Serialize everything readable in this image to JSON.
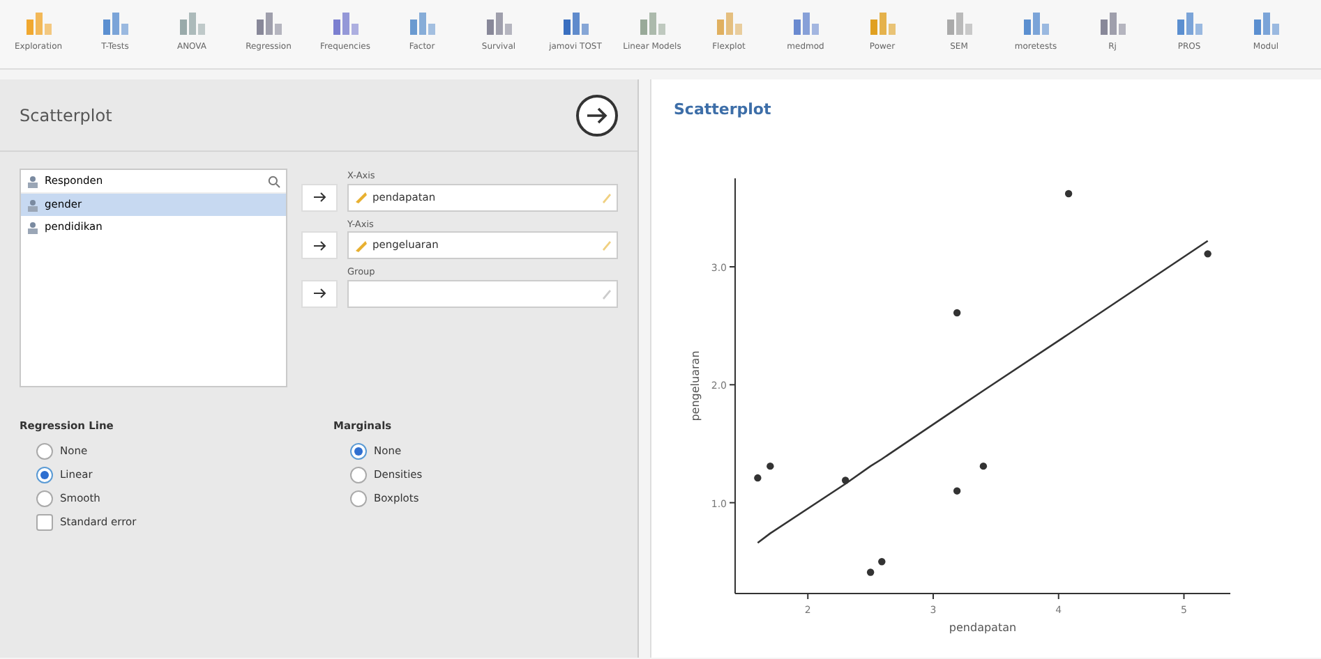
{
  "toolbar": [
    {
      "label": "Exploration"
    },
    {
      "label": "T-Tests"
    },
    {
      "label": "ANOVA"
    },
    {
      "label": "Regression"
    },
    {
      "label": "Frequencies"
    },
    {
      "label": "Factor"
    },
    {
      "label": "Survival"
    },
    {
      "label": "jamovi TOST"
    },
    {
      "label": "Linear Models"
    },
    {
      "label": "Flexplot"
    },
    {
      "label": "medmod"
    },
    {
      "label": "Power"
    },
    {
      "label": "SEM"
    },
    {
      "label": "moretests"
    },
    {
      "label": "Rj"
    },
    {
      "label": "PROS"
    },
    {
      "label": "Modul"
    }
  ],
  "options_panel": {
    "title": "Scatterplot",
    "variables": [
      {
        "name": "Responden",
        "kind": "nominal",
        "selected": false
      },
      {
        "name": "gender",
        "kind": "nominal",
        "selected": true
      },
      {
        "name": "pendidikan",
        "kind": "nominal",
        "selected": false
      }
    ],
    "targets": [
      {
        "label": "X-Axis",
        "value": "pendapatan"
      },
      {
        "label": "Y-Axis",
        "value": "pengeluaran"
      },
      {
        "label": "Group"
      }
    ],
    "regression_line": {
      "title": "Regression Line",
      "options": [
        {
          "label": "None",
          "kind": "radio",
          "selected": false
        },
        {
          "label": "Linear",
          "kind": "radio",
          "selected": true
        },
        {
          "label": "Smooth",
          "kind": "radio",
          "selected": false
        },
        {
          "label": "Standard error",
          "kind": "checkbox",
          "checked": false
        }
      ]
    },
    "marginals": {
      "title": "Marginals",
      "options": [
        {
          "label": "None",
          "selected": true
        },
        {
          "label": "Densities",
          "selected": false
        },
        {
          "label": "Boxplots",
          "selected": false
        }
      ]
    }
  },
  "results": {
    "title": "Scatterplot",
    "chart_data": {
      "type": "scatter",
      "xlabel": "pendapatan",
      "ylabel": "pengeluaran",
      "xlim": [
        1.42,
        5.37
      ],
      "ylim": [
        0.23,
        3.75
      ],
      "xticks": [
        2,
        3,
        4,
        5
      ],
      "yticks": [
        {
          "value": 1,
          "label": "1.0"
        },
        {
          "value": 2,
          "label": "2.0"
        },
        {
          "value": 3,
          "label": "3.0"
        }
      ],
      "x": [
        1.6,
        1.7,
        2.3,
        2.5,
        2.59,
        3.19,
        3.19,
        3.4,
        4.08,
        5.19
      ],
      "series": [
        {
          "type": "scatter",
          "color": "#333333",
          "values": [
            1.21,
            1.31,
            1.19,
            0.41,
            0.5,
            2.61,
            1.1,
            1.31,
            3.62,
            3.11
          ]
        },
        {
          "type": "line",
          "color": "#333333",
          "values": [
            0.66,
            0.74,
            1.16,
            1.31,
            1.37,
            1.8,
            1.8,
            1.95,
            2.43,
            3.22
          ]
        }
      ]
    }
  }
}
